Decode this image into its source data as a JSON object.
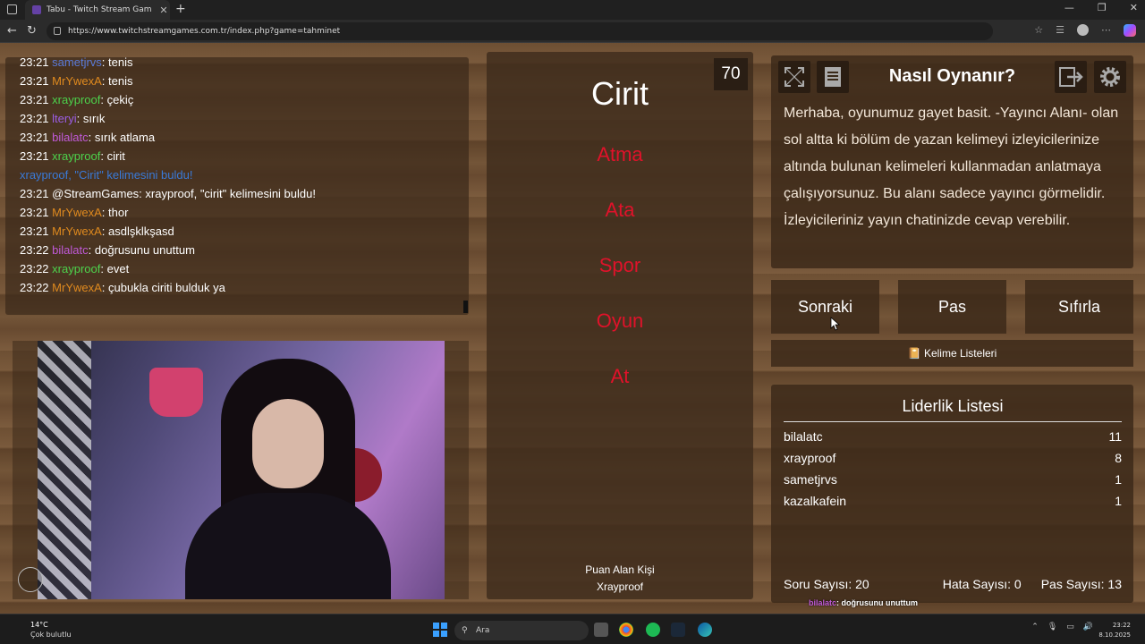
{
  "browser": {
    "tab_title": "Tabu - Twitch Stream Games",
    "url": "https://www.twitchstreamgames.com.tr/index.php?game=tahminet"
  },
  "chat": [
    {
      "time": "23:21",
      "user": "sametjrvs",
      "color": "#5a7ad8",
      "sep": ": ",
      "text": "tenis"
    },
    {
      "time": "23:21",
      "user": "MrYwexA",
      "color": "#e08a1e",
      "sep": ": ",
      "text": "tenis"
    },
    {
      "time": "23:21",
      "user": "xrayproof",
      "color": "#4cd24c",
      "sep": ": ",
      "text": "çekiç"
    },
    {
      "time": "23:21",
      "user": "lteryi",
      "color": "#9b5de5",
      "sep": ": ",
      "text": "sırık"
    },
    {
      "time": "23:21",
      "user": "bilalatc",
      "color": "#c05ad8",
      "sep": ": ",
      "text": "sırık atlama"
    },
    {
      "time": "23:21",
      "user": "xrayproof",
      "color": "#4cd24c",
      "sep": ": ",
      "text": "cirit"
    },
    {
      "time": "",
      "user": "xrayproof, \"Cirit\" kelimesini buldu!",
      "color": "#3a7ad8",
      "sep": "",
      "text": ""
    },
    {
      "time": "23:21",
      "user": "@StreamGames",
      "color": "#ffffff",
      "sep": ": ",
      "text": "xrayproof, \"cirit\" kelimesini buldu!"
    },
    {
      "time": "23:21",
      "user": "MrYwexA",
      "color": "#e08a1e",
      "sep": ": ",
      "text": "thor"
    },
    {
      "time": "23:21",
      "user": "MrYwexA",
      "color": "#e08a1e",
      "sep": ": ",
      "text": "asdlşklkşasd"
    },
    {
      "time": "23:22",
      "user": "bilalatc",
      "color": "#c05ad8",
      "sep": ": ",
      "text": "doğrusunu unuttum"
    },
    {
      "time": "23:22",
      "user": "xrayproof",
      "color": "#4cd24c",
      "sep": ": ",
      "text": "evet"
    },
    {
      "time": "23:22",
      "user": "MrYwexA",
      "color": "#e08a1e",
      "sep": ": ",
      "text": "çubukla ciriti bulduk ya"
    }
  ],
  "card": {
    "timer": "70",
    "word": "Cirit",
    "taboo": [
      "Atma",
      "Ata",
      "Spor",
      "Oyun",
      "At"
    ],
    "scorer_label": "Puan Alan Kişi",
    "scorer_name": "Xrayproof"
  },
  "help": {
    "title": "Nasıl Oynanır?",
    "text": "Merhaba, oyunumuz gayet basit. -Yayıncı Alanı- olan sol altta ki bölüm de yazan kelimeyi izleyicilerinize altında bulunan kelimeleri kullanmadan anlatmaya çalışıyorsunuz. Bu alanı sadece yayıncı görmelidir. İzleyicileriniz yayın chatinizde cevap verebilir."
  },
  "buttons": {
    "next": "Sonraki",
    "pass": "Pas",
    "reset": "Sıfırla",
    "lists": "Kelime Listeleri"
  },
  "leaderboard": {
    "title": "Liderlik Listesi",
    "rows": [
      {
        "name": "bilalatc",
        "score": "11"
      },
      {
        "name": "xrayproof",
        "score": "8"
      },
      {
        "name": "sametjrvs",
        "score": "1"
      },
      {
        "name": "kazalkafein",
        "score": "1"
      }
    ]
  },
  "stats": {
    "questions": "Soru Sayısı: 20",
    "errors": "Hata Sayısı: 0",
    "passes": "Pas Sayısı: 13"
  },
  "overlay_chat": [
    {
      "user": "bilalatc",
      "color": "#c05ad8",
      "text": ": doğrusunu unuttum"
    },
    {
      "user": "xrayproof",
      "color": "#4cd24c",
      "text": ": evet"
    },
    {
      "user": "MrYwexA",
      "color": "#e0a020",
      "text": ": çubukla ciriti bulduk ya"
    }
  ],
  "taskbar": {
    "temp": "14°C",
    "weather": "Çok bulutlu",
    "search": "Ara",
    "time": "23:22",
    "date": "8.10.2025"
  }
}
